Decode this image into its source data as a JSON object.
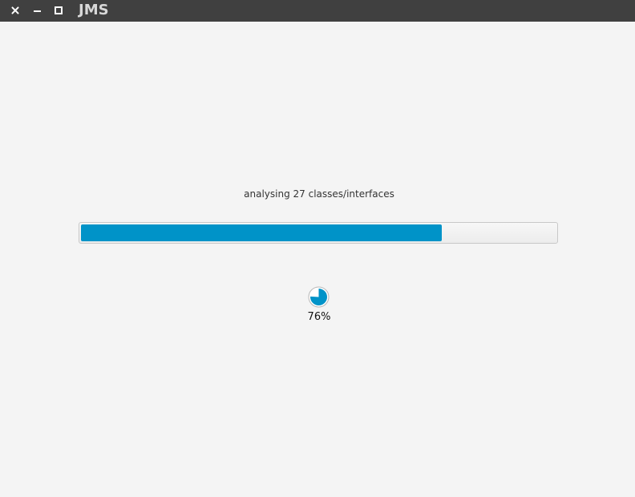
{
  "window": {
    "title": "JMS",
    "controls": {
      "close_icon": "close-icon",
      "minimize_icon": "minimize-icon",
      "maximize_icon": "maximize-icon"
    }
  },
  "analysis": {
    "status_text": "analysing 27 classes/interfaces",
    "progress_fraction": 0.76,
    "progress_label": "76%",
    "accent_color": "#0093c8"
  }
}
